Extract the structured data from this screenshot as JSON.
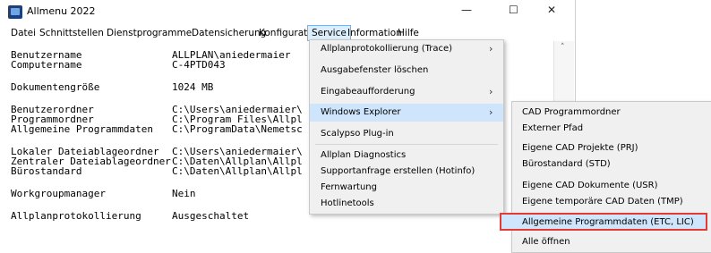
{
  "title": "Allmenu 2022",
  "window_controls": {
    "minimize": "—",
    "maximize": "☐",
    "close": "✕"
  },
  "menubar": [
    "Datei",
    "Schnittstellen",
    "Dienstprogramme",
    "Datensicherung",
    "Konfiguration",
    "Service",
    "Information",
    "Hilfe"
  ],
  "info": [
    {
      "label": "Benutzername",
      "value": "ALLPLAN\\aniedermaier"
    },
    {
      "label": "Computername",
      "value": "C-4PTD043"
    },
    {
      "label": "Dokumentengröße",
      "value": "1024 MB"
    },
    {
      "label": "Benutzerordner",
      "value": "C:\\Users\\aniedermaier\\"
    },
    {
      "label": "Programmordner",
      "value": "C:\\Program Files\\Allpl"
    },
    {
      "label": "Allgemeine Programmdaten",
      "value": "C:\\ProgramData\\Nemetsc"
    },
    {
      "label": "Lokaler Dateiablageordner",
      "value": "C:\\Users\\aniedermaier\\"
    },
    {
      "label": "Zentraler Dateiablageordner",
      "value": "C:\\Daten\\Allplan\\Allpl"
    },
    {
      "label": "Bürostandard",
      "value": "C:\\Daten\\Allplan\\Allpl"
    },
    {
      "label": "Workgroupmanager",
      "value": "Nein"
    },
    {
      "label": "Allplanprotokollierung",
      "value": "Ausgeschaltet"
    }
  ],
  "service_menu": [
    {
      "label": "Allplanprotokollierung (Trace)",
      "arrow": "›"
    },
    {
      "label": "Ausgabefenster löschen"
    },
    {
      "label": "Eingabeaufforderung",
      "arrow": "›"
    },
    {
      "label": "Windows Explorer",
      "arrow": "›"
    },
    {
      "label": "Scalypso Plug-in"
    },
    {
      "label": "Allplan Diagnostics"
    },
    {
      "label": "Supportanfrage erstellen (Hotinfo)"
    },
    {
      "label": "Fernwartung"
    },
    {
      "label": "Hotlinetools"
    }
  ],
  "explorer_submenu": [
    "CAD Programmordner",
    "Externer Pfad",
    "Eigene CAD Projekte (PRJ)",
    "Bürostandard (STD)",
    "Eigene CAD Dokumente (USR)",
    "Eigene temporäre CAD Daten (TMP)",
    "Allgemeine Programmdaten (ETC, LIC)",
    "Alle öffnen"
  ],
  "scroll_up": "˄",
  "colors": {
    "highlight": "#cfe5fb",
    "outline": "#e53935",
    "menu_bg": "#f0f0f0"
  }
}
